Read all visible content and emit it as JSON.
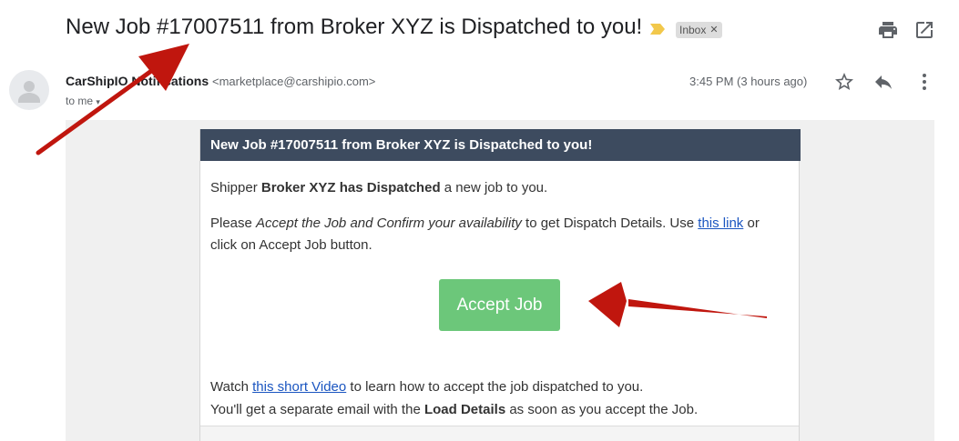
{
  "subject": "New Job #17007511 from Broker XYZ is Dispatched to you!",
  "label": "Inbox",
  "sender": {
    "name": "CarShipIO Notifications",
    "email": "<marketplace@carshipio.com>",
    "to": "to me"
  },
  "timestamp": "3:45 PM (3 hours ago)",
  "icons": {
    "importance": "importance-marker-icon",
    "print": "print-icon",
    "open_new": "open-in-new-window-icon",
    "avatar": "person-icon",
    "star": "star-icon",
    "reply": "reply-icon",
    "more": "more-vertical-icon"
  },
  "email": {
    "header": "New Job #17007511 from Broker XYZ is Dispatched to you!",
    "line1": {
      "pre": "Shipper ",
      "bold": "Broker XYZ has Dispatched",
      "post": " a new job to you."
    },
    "line2": {
      "pre": "Please ",
      "italic": "Accept the Job and Confirm your availability",
      "mid": " to get Dispatch Details. Use ",
      "link": "this link",
      "post": " or"
    },
    "line3": "click on Accept Job button.",
    "button": "Accept Job",
    "line4": {
      "pre": "Watch ",
      "link": "this short Video",
      "post": " to learn how to accept the job dispatched to you."
    },
    "line5": {
      "pre": "You'll get a separate email with the ",
      "bold": "Load Details",
      "post": " as soon as you accept the Job."
    }
  },
  "colors": {
    "header_bg": "#3d4b5f",
    "button_bg": "#6cc77a",
    "link": "#1a55c0",
    "annotation_arrow": "#c0160e"
  }
}
